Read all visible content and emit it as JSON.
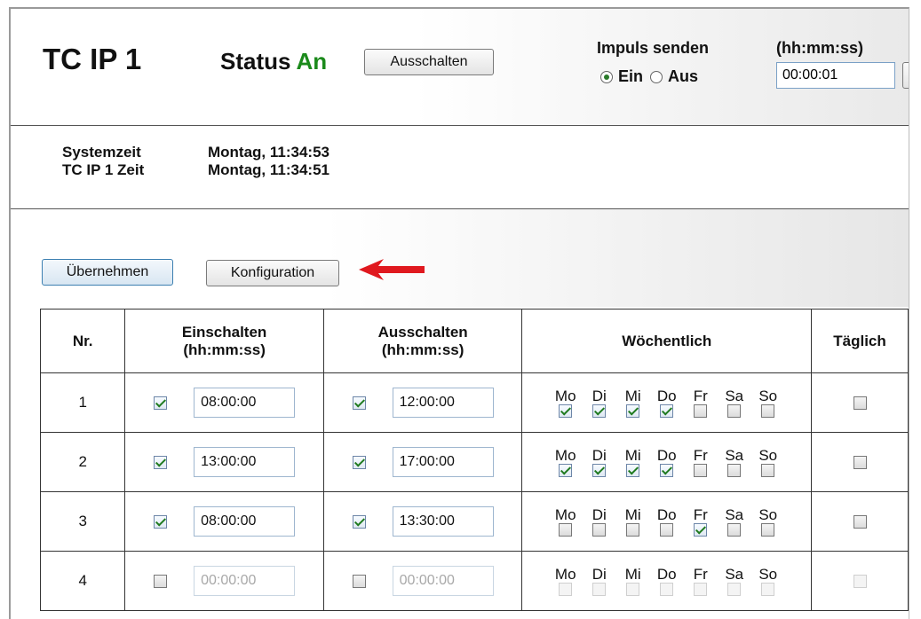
{
  "header": {
    "title": "TC IP 1",
    "status_label": "Status",
    "status_value": "An",
    "off_button": "Ausschalten",
    "impulse_title": "Impuls senden",
    "impulse_on": "Ein",
    "impulse_off": "Aus",
    "impulse_selected": "Ein",
    "duration_label": "(hh:mm:ss)",
    "duration_value": "00:00:01"
  },
  "times": {
    "system_label": "Systemzeit",
    "system_value": "Montag, 11:34:53",
    "device_label": "TC IP 1 Zeit",
    "device_value": "Montag, 11:34:51"
  },
  "actions": {
    "apply": "Übernehmen",
    "config": "Konfiguration"
  },
  "table": {
    "headers": {
      "nr": "Nr.",
      "on_line1": "Einschalten",
      "on_line2": "(hh:mm:ss)",
      "off_line1": "Ausschalten",
      "off_line2": "(hh:mm:ss)",
      "weekly": "Wöchentlich",
      "daily": "Täglich"
    },
    "day_labels": [
      "Mo",
      "Di",
      "Mi",
      "Do",
      "Fr",
      "Sa",
      "So"
    ],
    "rows": [
      {
        "nr": "1",
        "on_enabled": true,
        "on_time": "08:00:00",
        "off_enabled": true,
        "off_time": "12:00:00",
        "days": [
          true,
          true,
          true,
          true,
          false,
          false,
          false
        ],
        "daily": false,
        "disabled": false
      },
      {
        "nr": "2",
        "on_enabled": true,
        "on_time": "13:00:00",
        "off_enabled": true,
        "off_time": "17:00:00",
        "days": [
          true,
          true,
          true,
          true,
          false,
          false,
          false
        ],
        "daily": false,
        "disabled": false
      },
      {
        "nr": "3",
        "on_enabled": true,
        "on_time": "08:00:00",
        "off_enabled": true,
        "off_time": "13:30:00",
        "days": [
          false,
          false,
          false,
          false,
          true,
          false,
          false
        ],
        "daily": false,
        "disabled": false
      },
      {
        "nr": "4",
        "on_enabled": false,
        "on_time": "00:00:00",
        "off_enabled": false,
        "off_time": "00:00:00",
        "days": [
          false,
          false,
          false,
          false,
          false,
          false,
          false
        ],
        "daily": false,
        "disabled": true
      }
    ]
  },
  "colors": {
    "status_on": "#1b8a1b",
    "arrow": "#e0191f"
  }
}
